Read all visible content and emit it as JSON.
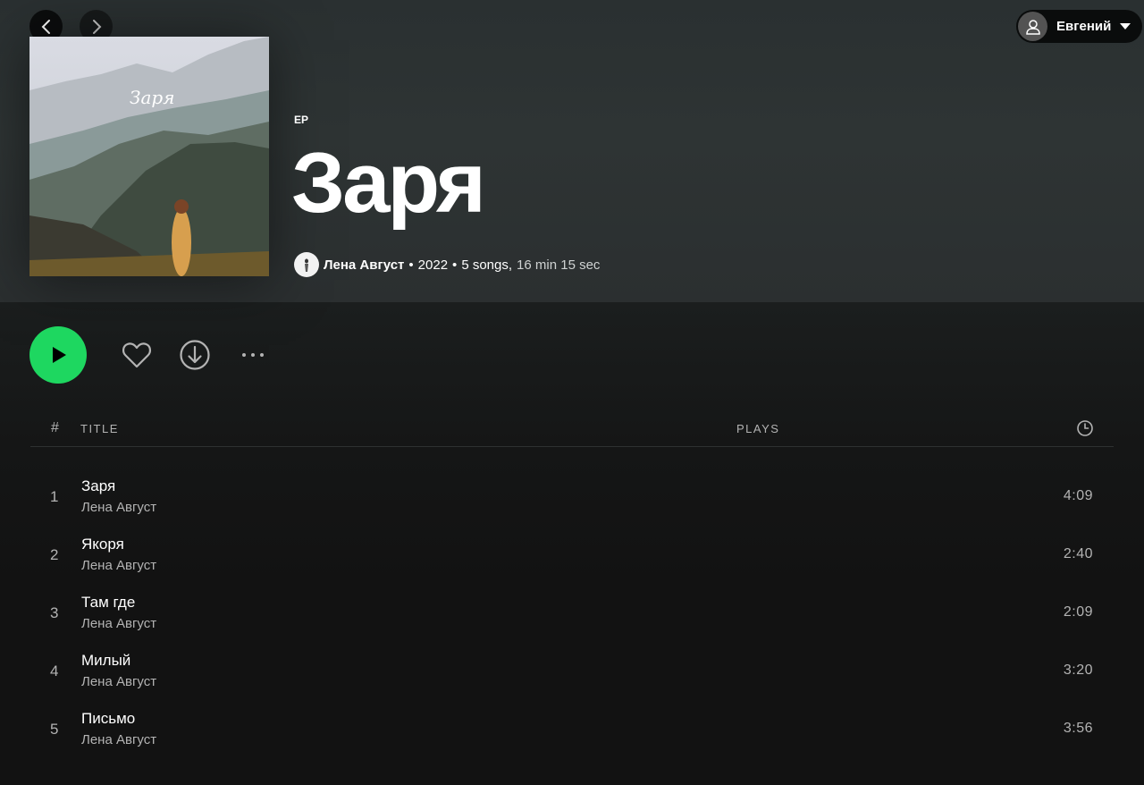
{
  "nav": {
    "back_icon": "chevron-left-icon",
    "forward_icon": "chevron-right-icon"
  },
  "user": {
    "name": "Евгений",
    "avatar_icon": "user-icon",
    "caret_icon": "caret-down-icon"
  },
  "album": {
    "cover_text": "Заря",
    "type": "EP",
    "title": "Заря",
    "artist": "Лена Август",
    "year": "2022",
    "songs": "5 songs,",
    "duration": "16 min 15 sec"
  },
  "actions": {
    "play_icon": "play-icon",
    "like_icon": "heart-icon",
    "download_icon": "download-icon",
    "more_icon": "more-icon"
  },
  "table": {
    "col_num": "#",
    "col_title": "TITLE",
    "col_plays": "PLAYS",
    "col_duration_icon": "clock-icon",
    "tracks": [
      {
        "num": "1",
        "title": "Заря",
        "artist": "Лена Август",
        "duration": "4:09"
      },
      {
        "num": "2",
        "title": "Якоря",
        "artist": "Лена Август",
        "duration": "2:40"
      },
      {
        "num": "3",
        "title": "Там где",
        "artist": "Лена Август",
        "duration": "2:09"
      },
      {
        "num": "4",
        "title": "Милый",
        "artist": "Лена Август",
        "duration": "3:20"
      },
      {
        "num": "5",
        "title": "Письмо",
        "artist": "Лена Август",
        "duration": "3:56"
      }
    ]
  },
  "colors": {
    "accent": "#1ed760",
    "background": "#121212",
    "header": "#2e3434"
  }
}
